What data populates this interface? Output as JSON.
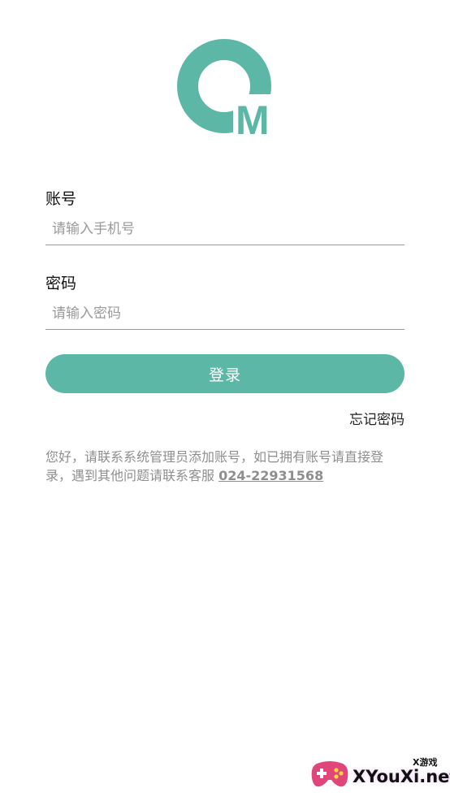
{
  "app": {
    "logo_letter": "M",
    "brand_color": "#5db7a6"
  },
  "form": {
    "account_label": "账号",
    "account_placeholder": "请输入手机号",
    "password_label": "密码",
    "password_placeholder": "请输入密码",
    "login_button": "登录",
    "forgot_password": "忘记密码"
  },
  "notice": {
    "text": "您好，请联系系统管理员添加账号，如已拥有账号请直接登录，遇到其他问题请联系客服 ",
    "phone": "024-22931568"
  },
  "watermark": {
    "sub": "X游戏",
    "main": "XYouXi.net"
  }
}
